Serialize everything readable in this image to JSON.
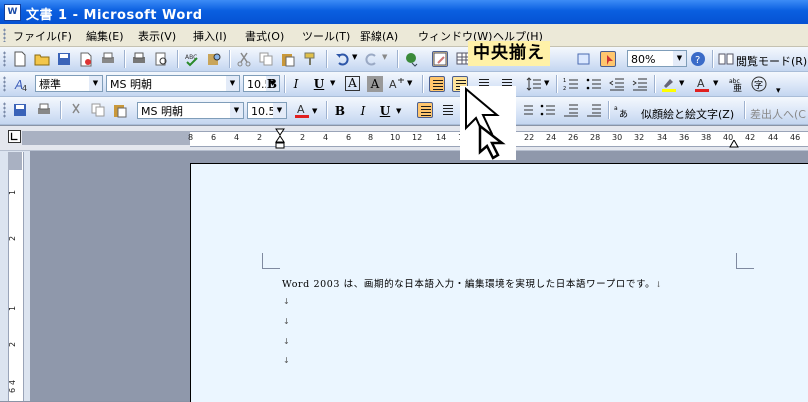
{
  "window": {
    "title": "文書 1 - Microsoft Word"
  },
  "menu": [
    "ファイル(F)",
    "編集(E)",
    "表示(V)",
    "挿入(I)",
    "書式(O)",
    "ツール(T)",
    "罫線(A)",
    "ウィンドウ(W)",
    "ヘルプ(H)"
  ],
  "standard_toolbar": {
    "zoom": "80%",
    "reading_mode": "閲覧モード(R)"
  },
  "formatting_toolbar": {
    "style": "標準",
    "font": "MS 明朝",
    "size": "10.5",
    "active_alignment": "center"
  },
  "third_toolbar": {
    "font": "MS 明朝",
    "size": "10.5",
    "kana_convert": "似顔絵と絵文字(Z)",
    "insert_diff": "差出人へ(C"
  },
  "tooltip": "中央揃え",
  "ruler": {
    "labels": [
      "8",
      "6",
      "4",
      "2",
      "2",
      "4",
      "6",
      "8",
      "10",
      "12",
      "14",
      "16",
      "18",
      "20",
      "22",
      "24",
      "26",
      "28",
      "30",
      "32",
      "34",
      "36",
      "38",
      "40",
      "42",
      "44",
      "46"
    ]
  },
  "vertical_ruler": {
    "labels": [
      "1",
      "2",
      "1",
      "2",
      "4",
      "6"
    ]
  },
  "document": {
    "body": "Word 2003 は、画期的な日本語入力・編集環境を実現した日本語ワープロです。",
    "para_mark": "↓",
    "empty_paragraphs": 4
  }
}
